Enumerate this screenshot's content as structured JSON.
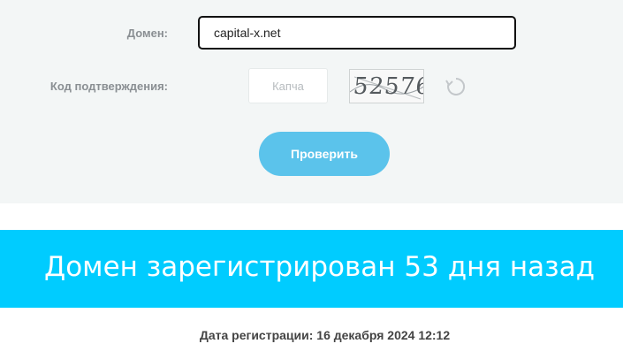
{
  "form": {
    "domain_label": "Домен:",
    "domain_value": "capital-x.net",
    "code_label": "Код подтверждения:",
    "captcha_placeholder": "Капча",
    "captcha_image_text": "52576",
    "check_button_label": "Проверить"
  },
  "icons": {
    "refresh": "refresh-icon"
  },
  "result": {
    "banner_text": "Домен зарегистрирован 53 дня назад",
    "registration_date": "Дата регистрации: 16 декабря 2024 12:12"
  },
  "colors": {
    "panel_bg": "#f3f6f6",
    "button_bg": "#5bc3eb",
    "banner_bg": "#00ccff"
  }
}
